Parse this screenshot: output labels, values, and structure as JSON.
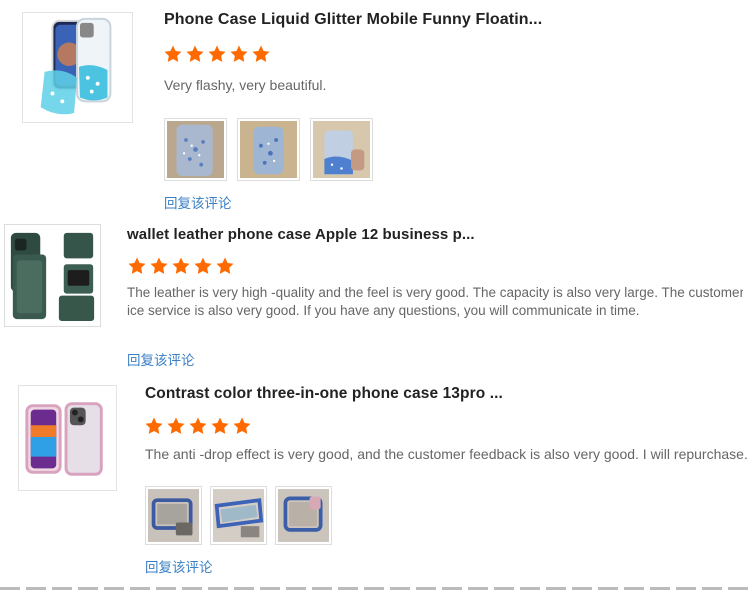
{
  "colors": {
    "star": "#ff6a00",
    "reply_link": "#3a7fc4",
    "title": "#222222",
    "text": "#666666"
  },
  "reviews": [
    {
      "title": "Phone Case Liquid Glitter Mobile Funny Floatin...",
      "rating": 5,
      "text": "Very flashy, very beautiful.",
      "reply": "回复该评论",
      "photos": [
        "glitter-photo-1",
        "glitter-photo-2",
        "glitter-photo-3"
      ]
    },
    {
      "title": "wallet leather phone case Apple 12 business p...",
      "rating": 5,
      "text_line1": "The leather is very high -quality and the feel is very good. The capacity is also very large. The customer serv",
      "text_line2": "ice service is also very good. If you have any questions, you will communicate in time.",
      "reply": "回复该评论",
      "photos": []
    },
    {
      "title": "Contrast color three-in-one phone case 13pro ...",
      "rating": 5,
      "text": "The anti -drop effect is very good, and the customer feedback is also very good. I will repurchase.",
      "reply": "回复该评论",
      "photos": [
        "bumper-photo-1",
        "bumper-photo-2",
        "bumper-photo-3"
      ]
    }
  ]
}
